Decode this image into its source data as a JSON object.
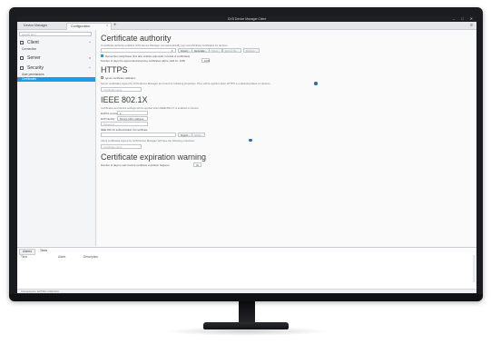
{
  "window": {
    "title": "GXS Device Manager Client",
    "controls": [
      "‒",
      "□",
      "✕"
    ]
  },
  "tabs": [
    {
      "label": "Device Manager",
      "active": false
    },
    {
      "label": "Configuration",
      "active": true
    }
  ],
  "tab_close": "×",
  "tab_add": "+",
  "menu_icon": "≡",
  "sidebar": {
    "search_placeholder": "search term",
    "groups": [
      {
        "label": "Client",
        "icon": "client-icon",
        "chevron": "^",
        "items": [
          {
            "label": "Connection",
            "selected": false
          }
        ]
      },
      {
        "label": "Server",
        "icon": "server-icon",
        "chevron": "v",
        "items": []
      },
      {
        "label": "Security",
        "icon": "security-icon",
        "chevron": "^",
        "items": [
          {
            "label": "User permissions",
            "selected": false
          },
          {
            "label": "Certificates",
            "selected": true
          }
        ]
      }
    ]
  },
  "cert_authority": {
    "title": "Certificate authority",
    "desc": "If certificate authority enabled, GXS Device Manager can automatically sign and distribute certificates for devices.",
    "buttons": {
      "import": "Import...",
      "generate": "Generate...",
      "show": "Show...",
      "export": "Export file...",
      "backup": "Backup..."
    },
    "remember_label": "Remember passphrase (this also enables automatic renewal of certificates)",
    "validity_label": "Number of days the signed device/service certificates will be valid for: 1095",
    "validity_value": "1095"
  },
  "https": {
    "title": "HTTPS",
    "ignore_label": "Ignore certificate validation",
    "desc": "Server certificates signed by GXS Device Manager are found for following properties. They will be applied when HTTPS is enabled/updated on devices.",
    "cert_placeholder": "Certificate name"
  },
  "ieee": {
    "title": "IEEE 802.1X",
    "desc": "Certificates and device settings will be applied when IEEE 802.1X is enabled on device.",
    "eapol_label": "EAPOL version:",
    "eapol_value": "2",
    "eap_label": "EAP identity:",
    "eap_value": "Device MAC address",
    "password_placeholder": "Password",
    "ca_label": "IEEE 802.1X authentication CA certificate",
    "import": "Import...",
    "show": "Show...",
    "client_desc": "Client certificates signed by GXS Device Manager will have the following properties:",
    "cert_placeholder": "Certificate name"
  },
  "expiration": {
    "title": "Certificate expiration warning",
    "label": "Number of days to warn before certificate expiration happens:",
    "value": "30"
  },
  "alarms": {
    "tabs": [
      {
        "label": "Alarms",
        "active": true
      },
      {
        "label": "Tasks",
        "active": false
      }
    ],
    "columns": [
      "Time",
      "Alarm",
      "Description"
    ]
  },
  "status": {
    "text": "Connected to: EXTIRC-CAM-SCC"
  }
}
